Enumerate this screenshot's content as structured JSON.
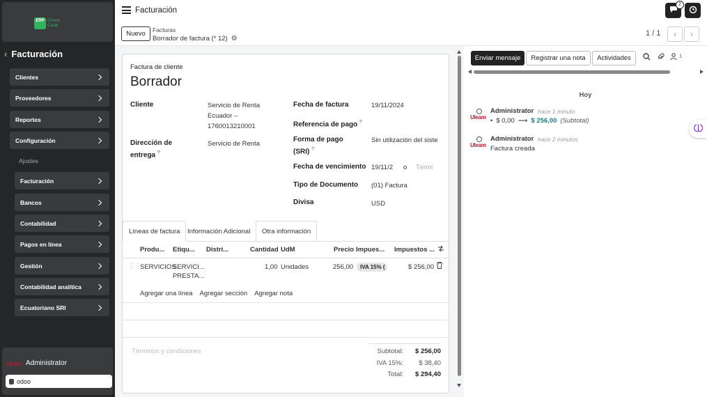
{
  "sidebar": {
    "logo_mark": "ERP",
    "logo_name_1": "Green",
    "logo_name_2": "Code",
    "title": "Facturación",
    "items": [
      {
        "label": "Clientes"
      },
      {
        "label": "Proveedores"
      },
      {
        "label": "Reportes"
      },
      {
        "label": "Configuración"
      }
    ],
    "sub_heading": "Ajustes",
    "sub_items": [
      {
        "label": "Facturación"
      },
      {
        "label": "Bancos"
      },
      {
        "label": "Contabilidad"
      },
      {
        "label": "Pagos en línea"
      },
      {
        "label": "Gestión"
      },
      {
        "label": "Contabilidad analítica"
      },
      {
        "label": "Ecuatoriano SRI"
      }
    ],
    "user_name": "Administrator",
    "avatar_text": "Uleam",
    "db_name": "odoo"
  },
  "topbar": {
    "app_title": "Facturación",
    "messages_count": "2"
  },
  "control_panel": {
    "new_label": "Nuevo",
    "breadcrumb_parent": "Facturas",
    "breadcrumb_current": "Borrador de factura (* 12)",
    "pager": "1 / 1"
  },
  "form": {
    "type_label": "Factura de cliente",
    "state_title": "Borrador",
    "cliente_label": "Cliente",
    "cliente_value_1": "Servicio de Renta",
    "cliente_value_2": "Ecuador –",
    "cliente_value_3": "1760013210001",
    "direccion_label_1": "Dirección de",
    "direccion_label_2": "entrega",
    "direccion_value": "Servicio de Renta",
    "fecha_factura_label": "Fecha de factura",
    "fecha_factura_value": "19/11/2024",
    "referencia_label": "Referencia de pago",
    "forma_pago_label_1": "Forma de pago",
    "forma_pago_label_2": "(SRI)",
    "forma_pago_value": "Sin utilización del siste",
    "vencimiento_label": "Fecha de vencimiento",
    "vencimiento_value": "19/11/2",
    "vencimiento_or": "o",
    "vencimiento_terms": "Térmi",
    "tipo_doc_label": "Tipo de Documento",
    "tipo_doc_value": "(01) Factura",
    "divisa_label": "Divisa",
    "divisa_value": "USD",
    "help_mark": "?"
  },
  "tabs": [
    {
      "label": "Líneas de factura"
    },
    {
      "label": "Información Adicional"
    },
    {
      "label": "Otra información"
    }
  ],
  "table": {
    "columns": [
      "Produ...",
      "Etiqu...",
      "Distri...",
      "Cantidad",
      "UdM",
      "Precio",
      "Impues...",
      "Impuestos ..."
    ],
    "rows": [
      {
        "product": "SERVICIOS",
        "label_1": "SERVICI...",
        "label_2": "PRESTA...",
        "quantity": "1,00",
        "uom": "Unidades",
        "price": "256,00",
        "tax": "IVA 15% (",
        "subtotal": "$ 256,00"
      }
    ],
    "add_line": "Agregar una línea",
    "add_section": "Agregar sección",
    "add_note": "Agregar nota"
  },
  "footer": {
    "terms_placeholder": "Términos y condiciones",
    "subtotal_label": "Subtotal:",
    "subtotal_value": "$ 256,00",
    "tax_label": "IVA 15%:",
    "tax_value": "$ 38,40",
    "total_label": "Total:",
    "total_value": "$ 294,40"
  },
  "chatter": {
    "send_message": "Enviar mensaje",
    "log_note": "Registrar una nota",
    "activities": "Actividades",
    "followers_count": "1",
    "today_label": "Hoy",
    "messages": [
      {
        "author": "Administrator",
        "time": "hace 1 minuto",
        "old_value": "$ 0,00",
        "new_value": "$ 256,00",
        "field": "(Subtotal)"
      },
      {
        "author": "Administrator",
        "time": "hace 2 minutos",
        "body": "Factura creada"
      }
    ],
    "logo_word": "Uleam"
  }
}
